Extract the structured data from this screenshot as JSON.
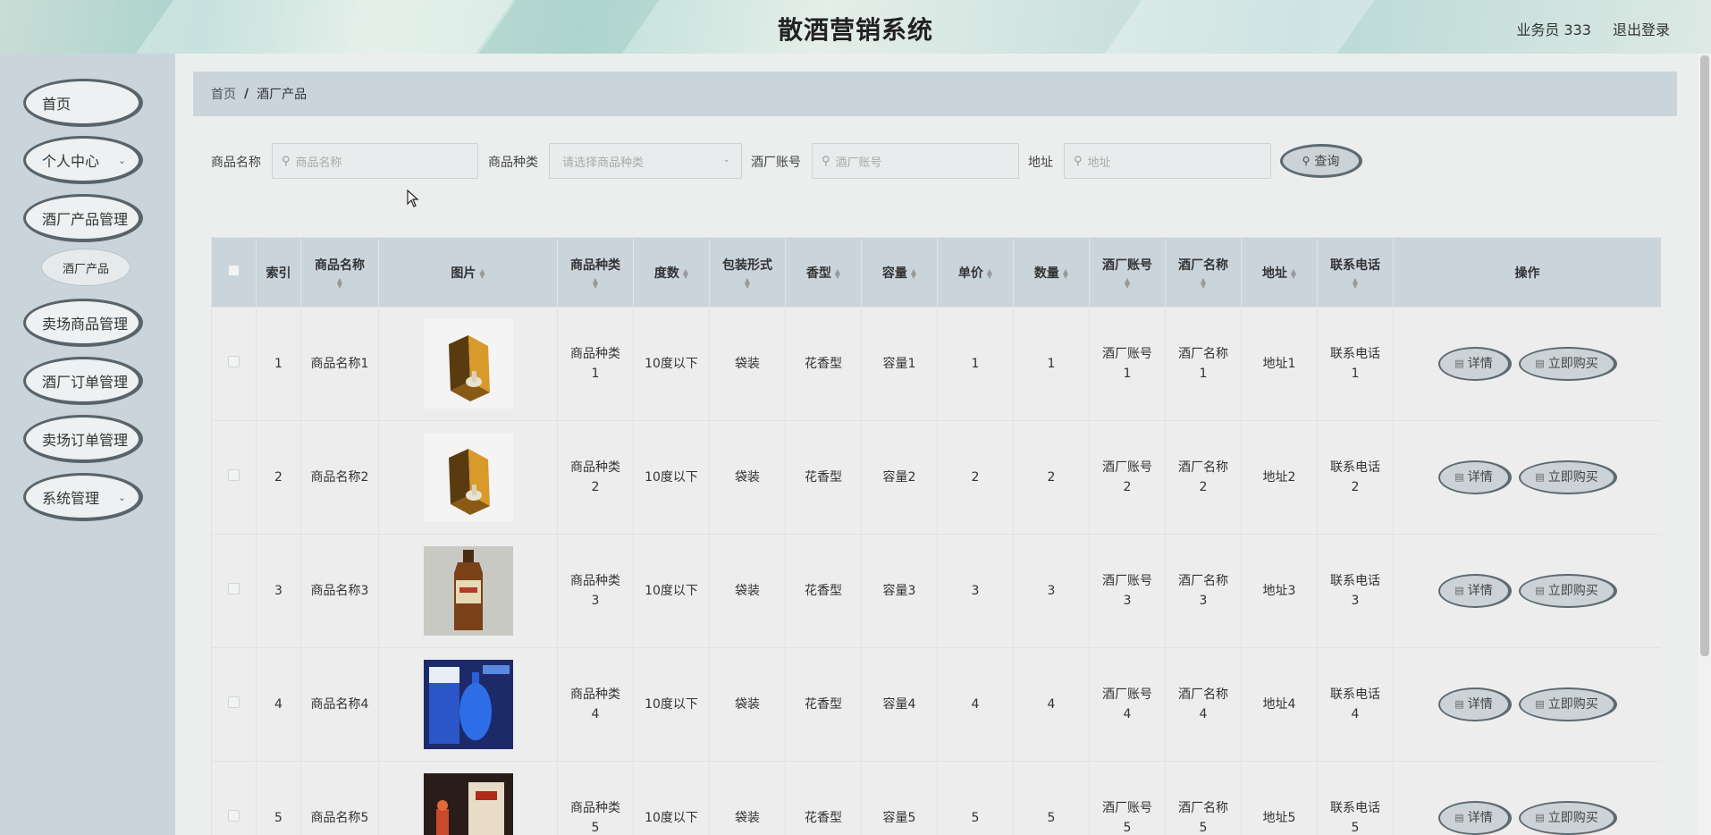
{
  "header": {
    "title": "散酒营销系统",
    "user": "业务员 333",
    "logout": "退出登录"
  },
  "sidebar": {
    "items": [
      {
        "label": "首页",
        "has_chevron": false
      },
      {
        "label": "个人中心",
        "has_chevron": true
      },
      {
        "label": "酒厂产品管理",
        "has_chevron": false
      },
      {
        "label": "卖场商品管理",
        "has_chevron": false
      },
      {
        "label": "酒厂订单管理",
        "has_chevron": false
      },
      {
        "label": "卖场订单管理",
        "has_chevron": false
      },
      {
        "label": "系统管理",
        "has_chevron": true
      }
    ],
    "submenu": {
      "label": "酒厂产品"
    }
  },
  "breadcrumb": {
    "home": "首页",
    "sep": "/",
    "current": "酒厂产品"
  },
  "search": {
    "name_label": "商品名称",
    "name_placeholder": "商品名称",
    "type_label": "商品种类",
    "type_placeholder": "请选择商品种类",
    "account_label": "酒厂账号",
    "account_placeholder": "酒厂账号",
    "address_label": "地址",
    "address_placeholder": "地址",
    "query_label": "查询"
  },
  "table": {
    "columns": [
      "索引",
      "商品名称",
      "图片",
      "商品种类",
      "度数",
      "包装形式",
      "香型",
      "容量",
      "单价",
      "数量",
      "酒厂账号",
      "酒厂名称",
      "地址",
      "联系电话",
      "操作"
    ],
    "detail_label": "详情",
    "buy_label": "立即购买",
    "rows": [
      {
        "index": "1",
        "name": "商品名称1",
        "image": "gift-box",
        "type": "商品种类1",
        "degree": "10度以下",
        "pack": "袋装",
        "aroma": "花香型",
        "capacity": "容量1",
        "price": "1",
        "qty": "1",
        "account": "酒厂账号1",
        "factory": "酒厂名称1",
        "address": "地址1",
        "phone": "联系电话1"
      },
      {
        "index": "2",
        "name": "商品名称2",
        "image": "gift-box",
        "type": "商品种类2",
        "degree": "10度以下",
        "pack": "袋装",
        "aroma": "花香型",
        "capacity": "容量2",
        "price": "2",
        "qty": "2",
        "account": "酒厂账号2",
        "factory": "酒厂名称2",
        "address": "地址2",
        "phone": "联系电话2"
      },
      {
        "index": "3",
        "name": "商品名称3",
        "image": "amber-bottle",
        "type": "商品种类3",
        "degree": "10度以下",
        "pack": "袋装",
        "aroma": "花香型",
        "capacity": "容量3",
        "price": "3",
        "qty": "3",
        "account": "酒厂账号3",
        "factory": "酒厂名称3",
        "address": "地址3",
        "phone": "联系电话3"
      },
      {
        "index": "4",
        "name": "商品名称4",
        "image": "blue-bottle",
        "type": "商品种类4",
        "degree": "10度以下",
        "pack": "袋装",
        "aroma": "花香型",
        "capacity": "容量4",
        "price": "4",
        "qty": "4",
        "account": "酒厂账号4",
        "factory": "酒厂名称4",
        "address": "地址4",
        "phone": "联系电话4"
      },
      {
        "index": "5",
        "name": "商品名称5",
        "image": "red-box",
        "type": "商品种类5",
        "degree": "10度以下",
        "pack": "袋装",
        "aroma": "花香型",
        "capacity": "容量5",
        "price": "5",
        "qty": "5",
        "account": "酒厂账号5",
        "factory": "酒厂名称5",
        "address": "地址5",
        "phone": "联系电话5"
      }
    ]
  },
  "colors": {
    "sidebar_bg": "#c9d5db",
    "table_header_bg": "#c9d5db",
    "button_border": "#5d6a70"
  }
}
